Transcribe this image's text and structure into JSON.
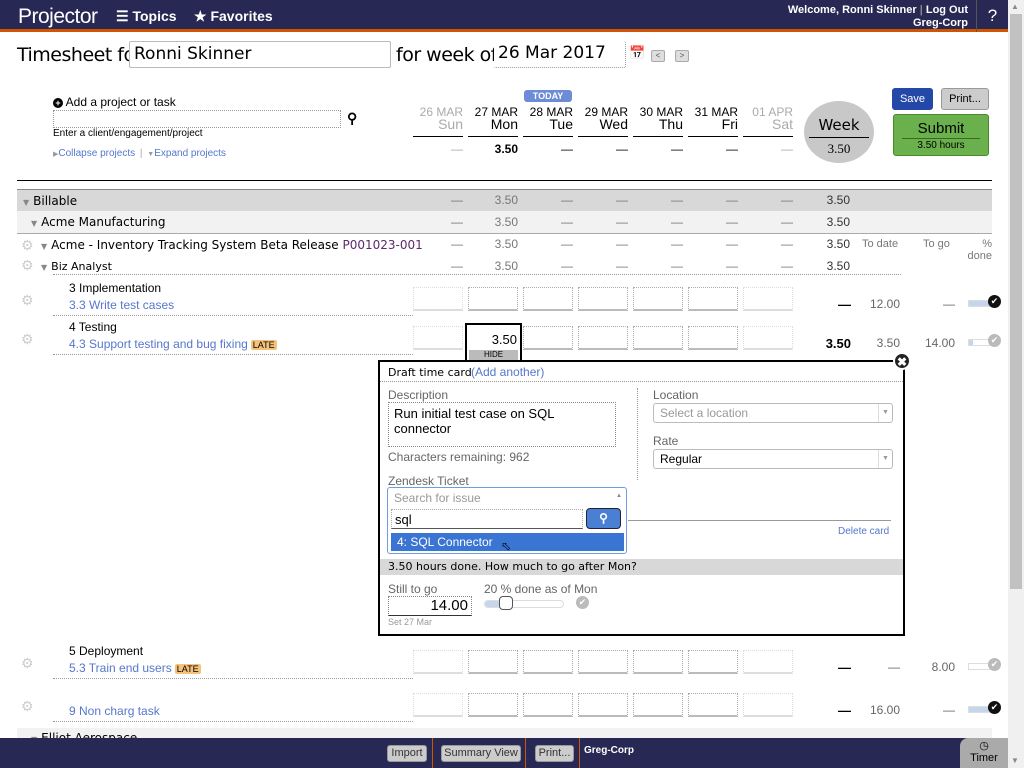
{
  "topbar": {
    "logo": "Projector",
    "nav": [
      {
        "icon": "menu-icon",
        "label": "Topics"
      },
      {
        "icon": "star-icon",
        "label": "Favorites"
      }
    ],
    "welcome": "Welcome, Ronni Skinner",
    "logout": "Log Out",
    "company": "Greg-Corp",
    "help": "?"
  },
  "header": {
    "timesheet_for": "Timesheet for",
    "user": "Ronni Skinner",
    "for_week_of": "for week of",
    "week_date": "26 Mar 2017",
    "prev": "<",
    "next": ">"
  },
  "add_project": {
    "label": "Add a project or task",
    "hint": "Enter a client/engagement/project",
    "collapse": "Collapse projects",
    "expand": "Expand projects"
  },
  "days": [
    {
      "date": "26 MAR",
      "dow": "Sun",
      "total": "—",
      "weekend": true
    },
    {
      "date": "27 MAR",
      "dow": "Mon",
      "total": "3.50",
      "weekend": false
    },
    {
      "date": "28 MAR",
      "dow": "Tue",
      "total": "—",
      "weekend": false
    },
    {
      "date": "29 MAR",
      "dow": "Wed",
      "total": "—",
      "weekend": false
    },
    {
      "date": "30 MAR",
      "dow": "Thu",
      "total": "—",
      "weekend": false
    },
    {
      "date": "31 MAR",
      "dow": "Fri",
      "total": "—",
      "weekend": false
    },
    {
      "date": "01 APR",
      "dow": "Sat",
      "total": "—",
      "weekend": true
    }
  ],
  "today_badge": "TODAY",
  "week": {
    "label": "Week",
    "total": "3.50"
  },
  "buttons": {
    "save": "Save",
    "print": "Print...",
    "submit": "Submit",
    "submit_hours": "3.50 hours"
  },
  "groups": [
    {
      "name": "Billable",
      "values": [
        "—",
        "3.50",
        "—",
        "—",
        "—",
        "—",
        "—"
      ],
      "total": "3.50"
    },
    {
      "name": "Acme Manufacturing",
      "values": [
        "—",
        "3.50",
        "—",
        "—",
        "—",
        "—",
        "—"
      ],
      "total": "3.50"
    },
    {
      "name": "Acme - Inventory Tracking System Beta Release",
      "code": "P001023-001",
      "values": [
        "—",
        "3.50",
        "—",
        "—",
        "—",
        "—",
        "—"
      ],
      "total": "3.50"
    },
    {
      "name": "Biz Analyst",
      "values": [
        "—",
        "3.50",
        "—",
        "—",
        "—",
        "—",
        "—"
      ],
      "total": "3.50"
    }
  ],
  "columns": {
    "to_date": "To date",
    "to_go": "To go",
    "pct_done": "% done"
  },
  "tasks": [
    {
      "phase": "3 Implementation",
      "name": "3.3 Write test cases",
      "late": false,
      "week": "—",
      "to_date": "12.00",
      "to_go": "—",
      "pct": 100,
      "complete": true
    },
    {
      "phase": "4 Testing",
      "name": "4.3 Support testing and bug fixing",
      "late": true,
      "week": "3.50",
      "to_date": "3.50",
      "to_go": "14.00",
      "pct": 20,
      "complete": false,
      "mon_value": "3.50"
    },
    {
      "phase": "5 Deployment",
      "name": "5.3 Train end users",
      "late": true,
      "week": "—",
      "to_date": "—",
      "to_go": "8.00",
      "pct": 0,
      "complete": false
    },
    {
      "phase": "",
      "name": "9 Non charg task",
      "late": false,
      "week": "—",
      "to_date": "16.00",
      "to_go": "—",
      "pct": 100,
      "complete": true
    }
  ],
  "late_badge": "LATE",
  "hide_label": "HIDE",
  "next_group": "Elliot Aerospace",
  "timecard": {
    "title": "Draft time card",
    "add_another": "(Add another)",
    "description_label": "Description",
    "description": "Run initial test case on SQL connector",
    "chars_remaining": "Characters remaining: 962",
    "zendesk_label": "Zendesk Ticket",
    "zendesk_placeholder": "Search for issue",
    "zendesk_query": "sql",
    "zendesk_result": "4: SQL Connector",
    "location_label": "Location",
    "location_placeholder": "Select a location",
    "rate_label": "Rate",
    "rate_value": "Regular",
    "delete": "Delete card",
    "progress_question": "3.50 hours done. How much to go after Mon?",
    "still_to_go_label": "Still to go",
    "still_to_go": "14.00",
    "set_date": "Set 27 Mar",
    "pct_label": "20 % done as of Mon",
    "pct_done": 20
  },
  "footer": {
    "import": "Import",
    "summary": "Summary View",
    "print": "Print...",
    "company": "Greg-Corp",
    "timer": "Timer"
  },
  "colors": {
    "navy": "#272954",
    "accent": "#d35400",
    "save": "#2348a8",
    "submit": "#6ab04c",
    "link": "#5577cc",
    "late": "#f5c27a"
  }
}
